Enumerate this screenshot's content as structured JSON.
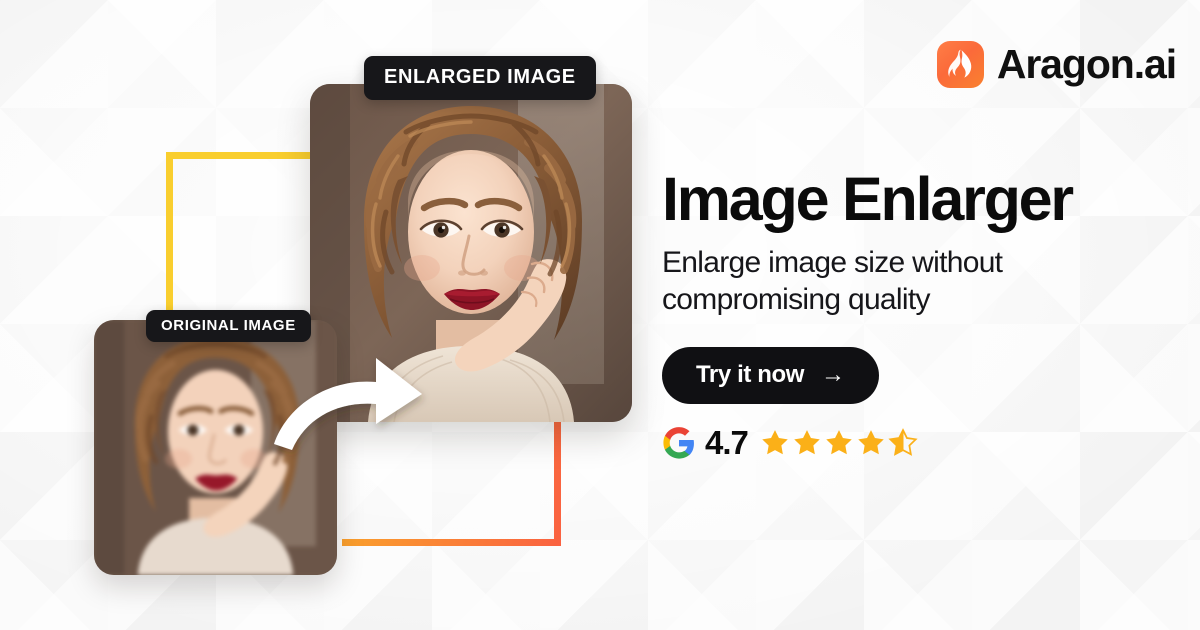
{
  "brand": {
    "name": "Aragon.ai",
    "logo_icon": "flame-icon",
    "logo_gradient_from": "#FF7E47",
    "logo_gradient_to": "#F9812F"
  },
  "hero": {
    "headline": "Image Enlarger",
    "subheadline": "Enlarge image size without compromising quality",
    "cta_label": "Try it now",
    "cta_arrow": "→",
    "cta_background": "#101013"
  },
  "rating": {
    "provider_icon": "google-g-icon",
    "score": "4.7",
    "stars_total": 5,
    "stars_filled": 4,
    "star_half": true,
    "star_color": "#FBB018"
  },
  "comparison": {
    "enlarged_label": "ENLARGED IMAGE",
    "original_label": "ORIGINAL IMAGE",
    "arrow_icon": "curved-arrow-icon",
    "badge_background": "#17171a",
    "frame_yellow_color": "#F9CE2E",
    "frame_orange_color": "#F96244",
    "photo_alt": "Portrait of a woman with curly auburn hair resting her hand on her cheek"
  }
}
